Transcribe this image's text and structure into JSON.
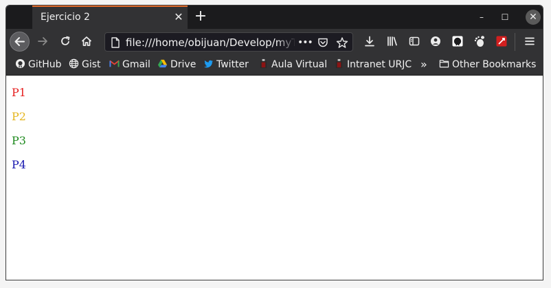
{
  "tab": {
    "title": "Ejercicio 2",
    "accent": "#e36b2a"
  },
  "url": {
    "value": "file:///home/obijuan/Develop/myTeachi",
    "more": "•••"
  },
  "bookmarks": [
    {
      "label": "GitHub"
    },
    {
      "label": "Gist"
    },
    {
      "label": "Gmail"
    },
    {
      "label": "Drive"
    },
    {
      "label": "Twitter"
    },
    {
      "label": "Aula Virtual"
    },
    {
      "label": "Intranet URJC"
    },
    {
      "label": "Other Bookmarks"
    }
  ],
  "paragraphs": [
    {
      "text": "P1",
      "color": "#e62020"
    },
    {
      "text": "P2",
      "color": "#e5b61f"
    },
    {
      "text": "P3",
      "color": "#1e8a1e"
    },
    {
      "text": "P4",
      "color": "#1717b0"
    }
  ],
  "icons": {
    "tab_close": "close-icon",
    "new_tab": "plus-icon",
    "back": "arrow-left-icon",
    "forward": "arrow-right-icon",
    "reload": "reload-icon",
    "home": "home-icon",
    "page": "page-icon",
    "pocket": "pocket-icon",
    "bookmark_star": "star-icon",
    "download": "download-icon",
    "library": "library-icon",
    "sidebar": "sidebar-icon",
    "account": "account-icon",
    "github": "github-icon",
    "gnome": "gnome-icon",
    "extension": "extension-icon",
    "menu": "menu-icon"
  }
}
